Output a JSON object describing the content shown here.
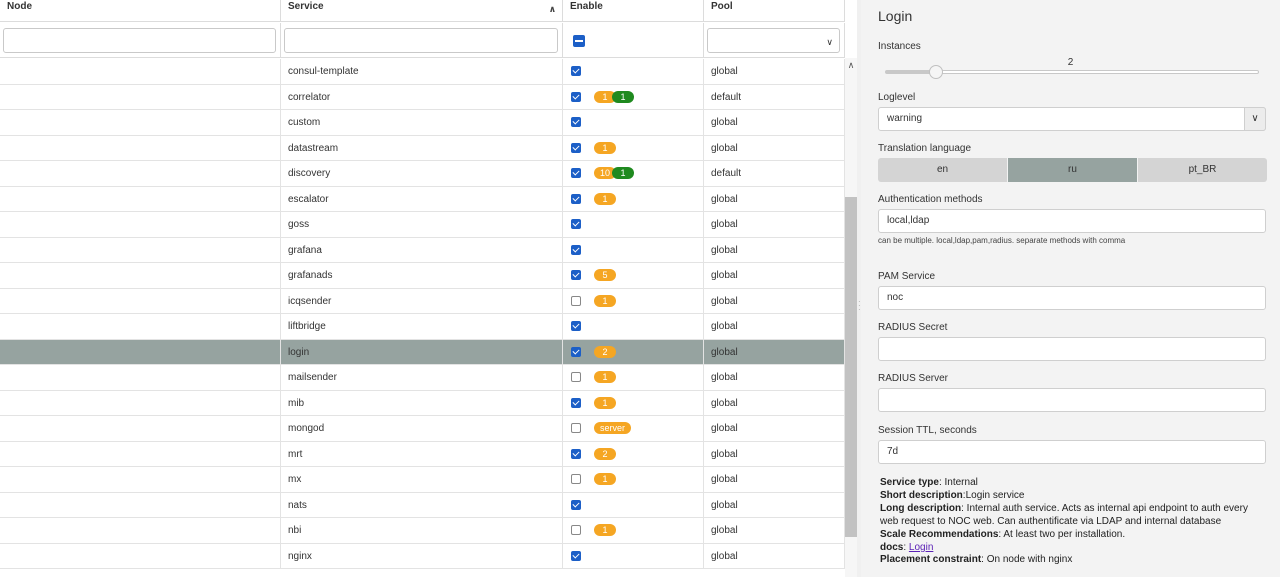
{
  "grid": {
    "columns": {
      "node": "Node",
      "service": "Service",
      "enable": "Enable",
      "pool": "Pool"
    },
    "icons": {
      "sort": "chevron-up-icon",
      "pool_filter": "chevron-down-icon",
      "scroll_up": "chevron-up-icon"
    },
    "rows": [
      {
        "node": "",
        "service": "consul-template",
        "enabled": true,
        "badges": [],
        "pool": "global"
      },
      {
        "node": "",
        "service": "correlator",
        "enabled": true,
        "badges": [
          {
            "text": "1",
            "color": "orange"
          },
          {
            "text": "1",
            "color": "green"
          }
        ],
        "pool": "default"
      },
      {
        "node": "",
        "service": "custom",
        "enabled": true,
        "badges": [],
        "pool": "global"
      },
      {
        "node": "",
        "service": "datastream",
        "enabled": true,
        "badges": [
          {
            "text": "1",
            "color": "orange"
          }
        ],
        "pool": "global"
      },
      {
        "node": "",
        "service": "discovery",
        "enabled": true,
        "badges": [
          {
            "text": "10",
            "color": "orange"
          },
          {
            "text": "1",
            "color": "green"
          }
        ],
        "pool": "default"
      },
      {
        "node": "",
        "service": "escalator",
        "enabled": true,
        "badges": [
          {
            "text": "1",
            "color": "orange"
          }
        ],
        "pool": "global"
      },
      {
        "node": "",
        "service": "goss",
        "enabled": true,
        "badges": [],
        "pool": "global"
      },
      {
        "node": "",
        "service": "grafana",
        "enabled": true,
        "badges": [],
        "pool": "global"
      },
      {
        "node": "",
        "service": "grafanads",
        "enabled": true,
        "badges": [
          {
            "text": "5",
            "color": "orange"
          }
        ],
        "pool": "global"
      },
      {
        "node": "",
        "service": "icqsender",
        "enabled": false,
        "badges": [
          {
            "text": "1",
            "color": "orange"
          }
        ],
        "pool": "global"
      },
      {
        "node": "",
        "service": "liftbridge",
        "enabled": true,
        "badges": [],
        "pool": "global"
      },
      {
        "node": "",
        "service": "login",
        "enabled": true,
        "badges": [
          {
            "text": "2",
            "color": "orange"
          }
        ],
        "pool": "global",
        "selected": true
      },
      {
        "node": "",
        "service": "mailsender",
        "enabled": false,
        "badges": [
          {
            "text": "1",
            "color": "orange"
          }
        ],
        "pool": "global"
      },
      {
        "node": "",
        "service": "mib",
        "enabled": true,
        "badges": [
          {
            "text": "1",
            "color": "orange"
          }
        ],
        "pool": "global"
      },
      {
        "node": "",
        "service": "mongod",
        "enabled": false,
        "badges": [
          {
            "text": "server",
            "color": "orange"
          }
        ],
        "pool": "global"
      },
      {
        "node": "",
        "service": "mrt",
        "enabled": true,
        "badges": [
          {
            "text": "2",
            "color": "orange"
          }
        ],
        "pool": "global"
      },
      {
        "node": "",
        "service": "mx",
        "enabled": false,
        "badges": [
          {
            "text": "1",
            "color": "orange"
          }
        ],
        "pool": "global"
      },
      {
        "node": "",
        "service": "nats",
        "enabled": true,
        "badges": [],
        "pool": "global"
      },
      {
        "node": "",
        "service": "nbi",
        "enabled": false,
        "badges": [
          {
            "text": "1",
            "color": "orange"
          }
        ],
        "pool": "global"
      },
      {
        "node": "",
        "service": "nginx",
        "enabled": true,
        "badges": [],
        "pool": "global"
      }
    ]
  },
  "panel": {
    "title": "Login",
    "instances": {
      "label": "Instances",
      "value": "2",
      "max_value": 20
    },
    "loglevel": {
      "label": "Loglevel",
      "value": "warning"
    },
    "translation": {
      "label": "Translation language",
      "options": [
        "en",
        "ru",
        "pt_BR"
      ],
      "selected": "ru"
    },
    "auth": {
      "label": "Authentication methods",
      "value": "local,ldap",
      "hint": "can be multiple. local,ldap,pam,radius. separate methods with comma"
    },
    "pam": {
      "label": "PAM Service",
      "value": "noc"
    },
    "radius_secret": {
      "label": "RADIUS Secret",
      "value": ""
    },
    "radius_server": {
      "label": "RADIUS Server",
      "value": ""
    },
    "session_ttl": {
      "label": "Session TTL, seconds",
      "value": "7d"
    },
    "info": {
      "service_type_label": "Service type",
      "service_type": ": Internal",
      "short_label": "Short description",
      "short": ":Login service",
      "long_label": "Long description",
      "long": ": Internal auth service. Acts as internal api endpoint to auth every web request to NOC web. Can authentificate via LDAP and internal database",
      "scale_label": "Scale Recommendations",
      "scale": ": At least two per installation.",
      "docs_label": "docs",
      "docs_sep": ": ",
      "docs_link": "Login",
      "placement_label": "Placement constraint",
      "placement": ": On node with nginx"
    },
    "colors": {
      "selected": "#96a3a0",
      "badge_orange": "#f5a623",
      "badge_green": "#1f8a1f",
      "checkbox": "#1c5fc7"
    }
  }
}
